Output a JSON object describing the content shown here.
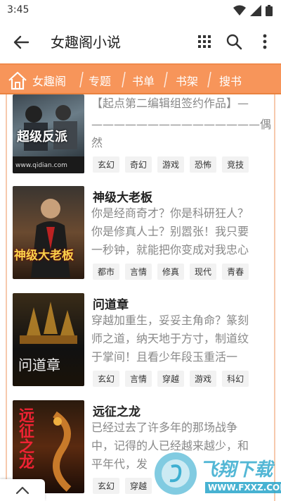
{
  "status": {
    "time": "3:45"
  },
  "appbar": {
    "title": "女趣阁小说"
  },
  "nav": {
    "items": [
      "女趣阁",
      "专题",
      "书单",
      "书架",
      "搜书"
    ],
    "accent": "#f7955a"
  },
  "books": [
    {
      "title": "",
      "desc_lines": [
        "【起点第二编辑组签约作品】—",
        "———————————————偶然"
      ],
      "tags": [
        "玄幻",
        "奇幻",
        "游戏",
        "恐怖",
        "竞技"
      ],
      "cover_text": "超级反派",
      "cover_site": "www.qidian.com"
    },
    {
      "title": "神级大老板",
      "desc_lines": [
        "你是经商奇才？你是科研狂人？",
        "你是修真人士？别嚣张！我只要",
        "一秒钟，就能把你变成对我忠心"
      ],
      "tags": [
        "都市",
        "言情",
        "修真",
        "现代",
        "青春"
      ],
      "cover_text": "神级大老板"
    },
    {
      "title": "问道章",
      "desc_lines": [
        "穿越加重生，妥妥主角命？篆刻",
        "师之道，纳天地于方寸，制道纹",
        "于掌间！且看少年段玉重活一"
      ],
      "tags": [
        "玄幻",
        "言情",
        "穿越",
        "游戏",
        "科幻"
      ],
      "cover_text": "问道章"
    },
    {
      "title": "远征之龙",
      "desc_lines": [
        "已经过去了许多年的那场战争",
        "中，记得的人已经越来越少，和",
        "平年代，发"
      ],
      "tags": [
        "玄幻",
        "穿越"
      ],
      "cover_text": "远征之龙"
    }
  ],
  "watermark": {
    "text": "飞翔下载",
    "url": "WWW.FXXZ.COM"
  }
}
